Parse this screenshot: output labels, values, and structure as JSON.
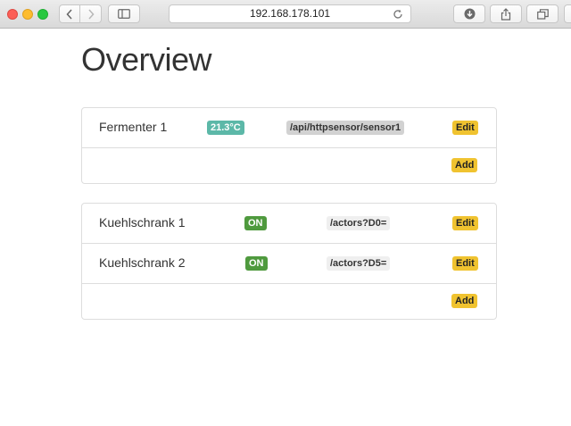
{
  "browser": {
    "address": "192.168.178.101"
  },
  "page": {
    "title": "Overview"
  },
  "sensors": {
    "rows": [
      {
        "name": "Fermenter 1",
        "value": "21.3°C",
        "endpoint": "/api/httpsensor/sensor1",
        "edit_label": "Edit"
      }
    ],
    "add_label": "Add"
  },
  "actors": {
    "rows": [
      {
        "name": "Kuehlschrank 1",
        "state": "ON",
        "endpoint": "/actors?D0=",
        "edit_label": "Edit"
      },
      {
        "name": "Kuehlschrank 2",
        "state": "ON",
        "endpoint": "/actors?D5=",
        "edit_label": "Edit"
      }
    ],
    "add_label": "Add"
  },
  "colors": {
    "temperature_badge": "#5cb8a8",
    "on_badge": "#4f9a3e",
    "sensor_endpoint_bg": "#d2d2d2",
    "actor_endpoint_bg": "#efefef",
    "button": "#f0c330"
  },
  "icons": {
    "back": "chevron-left-icon",
    "forward": "chevron-right-icon",
    "sidebar": "sidebar-icon",
    "reload": "reload-icon",
    "download": "download-icon",
    "share": "share-icon",
    "tabs": "tabs-icon"
  }
}
